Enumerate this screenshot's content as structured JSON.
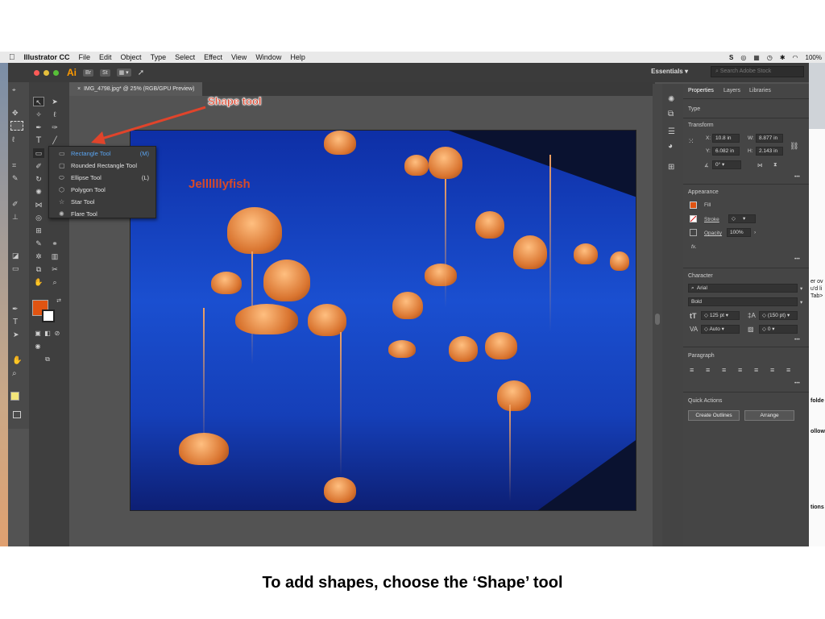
{
  "menubar": {
    "apple": "",
    "app_name": "Illustrator CC",
    "items": [
      "File",
      "Edit",
      "Object",
      "Type",
      "Select",
      "Effect",
      "View",
      "Window",
      "Help"
    ],
    "battery": "100%"
  },
  "titlebar": {
    "logo": "Ai",
    "bridge": "Br",
    "stock": "St",
    "workspace": "Essentials",
    "search_placeholder": "Search Adobe Stock"
  },
  "document": {
    "tab_label": "IMG_4798.jpg* @ 25% (RGB/GPU Preview)",
    "close_glyph": "×"
  },
  "flyout": {
    "items": [
      {
        "label": "Rectangle Tool",
        "shortcut": "(M)",
        "icon": "rectangle-icon"
      },
      {
        "label": "Rounded Rectangle Tool",
        "shortcut": "",
        "icon": "rounded-rectangle-icon"
      },
      {
        "label": "Ellipse Tool",
        "shortcut": "(L)",
        "icon": "ellipse-icon"
      },
      {
        "label": "Polygon Tool",
        "shortcut": "",
        "icon": "polygon-icon"
      },
      {
        "label": "Star Tool",
        "shortcut": "",
        "icon": "star-icon"
      },
      {
        "label": "Flare Tool",
        "shortcut": "",
        "icon": "flare-icon"
      }
    ]
  },
  "annotation": {
    "callout": "Shape tool",
    "artboard_text": "Jellllllyfish"
  },
  "properties": {
    "tabs": [
      "Properties",
      "Layers",
      "Libraries"
    ],
    "type_label": "Type",
    "transform": {
      "title": "Transform",
      "x_label": "X:",
      "x": "10.8 in",
      "y_label": "Y:",
      "y": "6.082 in",
      "w_label": "W:",
      "w": "8.877 in",
      "h_label": "H:",
      "h": "2.143 in",
      "angle": "0°"
    },
    "appearance": {
      "title": "Appearance",
      "fill": "Fill",
      "stroke": "Stroke",
      "opacity": "Opacity",
      "opacity_value": "100%",
      "fx": "fx.",
      "fill_color": "#e05412"
    },
    "character": {
      "title": "Character",
      "font": "Arial",
      "style": "Bold",
      "size": "125 pt",
      "leading": "(150 pt)",
      "kerning": "Auto",
      "tracking": "0"
    },
    "paragraph": {
      "title": "Paragraph"
    },
    "quick_actions": {
      "title": "Quick Actions",
      "create_outlines": "Create Outlines",
      "arrange": "Arrange"
    },
    "more": "•••"
  },
  "background_fragments": [
    "er ov",
    "u'd li",
    "Tab>",
    "folde",
    "ollow",
    "tions"
  ],
  "caption": "To add shapes, choose the ‘Shape’ tool",
  "colors": {
    "accent": "#e05412",
    "callout": "#e0442b",
    "panel": "#454545"
  }
}
